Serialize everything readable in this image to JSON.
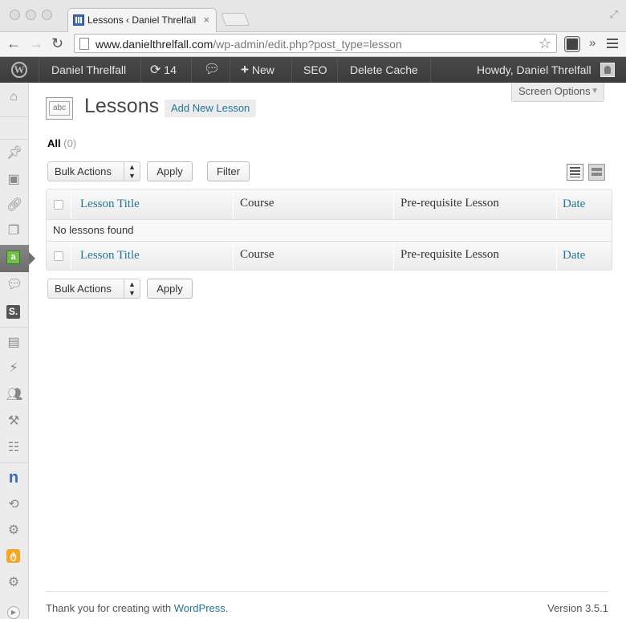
{
  "browser": {
    "tab_title": "Lessons ‹ Daniel Threlfall",
    "tab_close": "×",
    "url_domain": "www.danielthrelfall.com",
    "url_path": "/wp-admin/edit.php?post_type=lesson",
    "back": "←",
    "forward": "→",
    "reload": "↻",
    "star": "☆",
    "overflow": "»"
  },
  "adminbar": {
    "site_name": "Daniel Threlfall",
    "updates_count": "14",
    "new_label": "New",
    "seo_label": "SEO",
    "delete_cache_label": "Delete Cache",
    "howdy": "Howdy, Daniel Threlfall"
  },
  "screen_options": {
    "label": "Screen Options",
    "arrow": "▼"
  },
  "page": {
    "icon_text": "abc",
    "title": "Lessons",
    "add_new": "Add New Lesson"
  },
  "views": {
    "all_label": "All",
    "all_count": "(0)"
  },
  "bulk_top": {
    "select_value": "Bulk Actions",
    "apply": "Apply",
    "filter": "Filter"
  },
  "bulk_bottom": {
    "select_value": "Bulk Actions",
    "apply": "Apply"
  },
  "table": {
    "columns": [
      "Lesson Title",
      "Course",
      "Pre-requisite Lesson",
      "Date"
    ],
    "empty_message": "No lessons found"
  },
  "footer": {
    "thanks_prefix": "Thank you for creating with ",
    "wordpress_link": "WordPress",
    "thanks_suffix": ".",
    "version": "Version 3.5.1"
  }
}
